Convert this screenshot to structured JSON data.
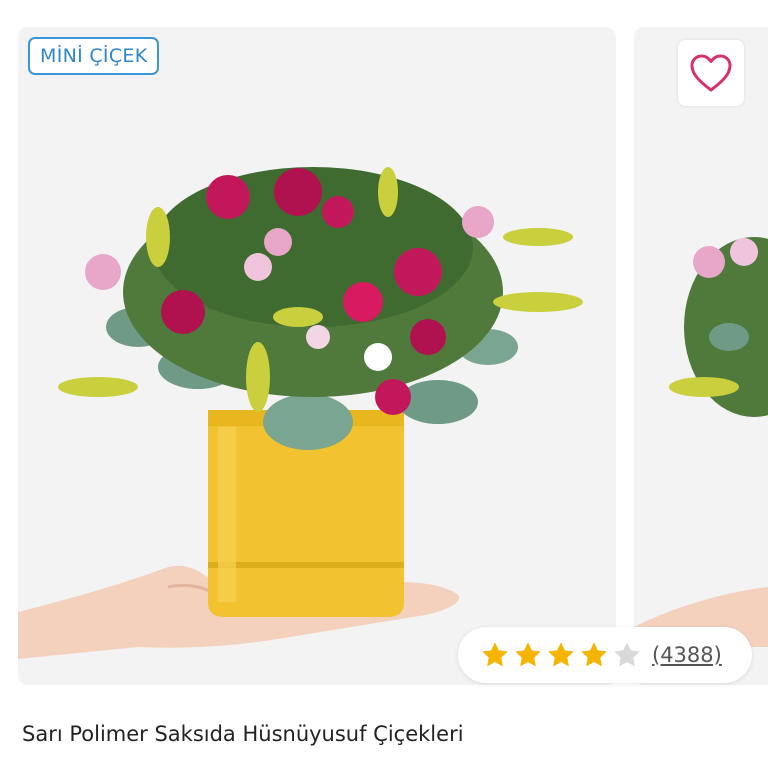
{
  "product": {
    "badge": "MİNİ ÇİÇEK",
    "title": "Sarı Polimer Saksıda Hüsnüyusuf Çiçekleri",
    "image_description": "flower-arrangement",
    "rating": {
      "stars_filled": 4,
      "stars_total": 5,
      "review_count_text": "(4388)"
    }
  },
  "icons": {
    "favorite": "heart-icon",
    "star": "star-icon"
  },
  "colors": {
    "badge_accent": "#2f86c9",
    "heart": "#d6336c",
    "star_filled": "#f4b400",
    "star_empty": "#d9d9d9",
    "pot": "#f2c230"
  }
}
